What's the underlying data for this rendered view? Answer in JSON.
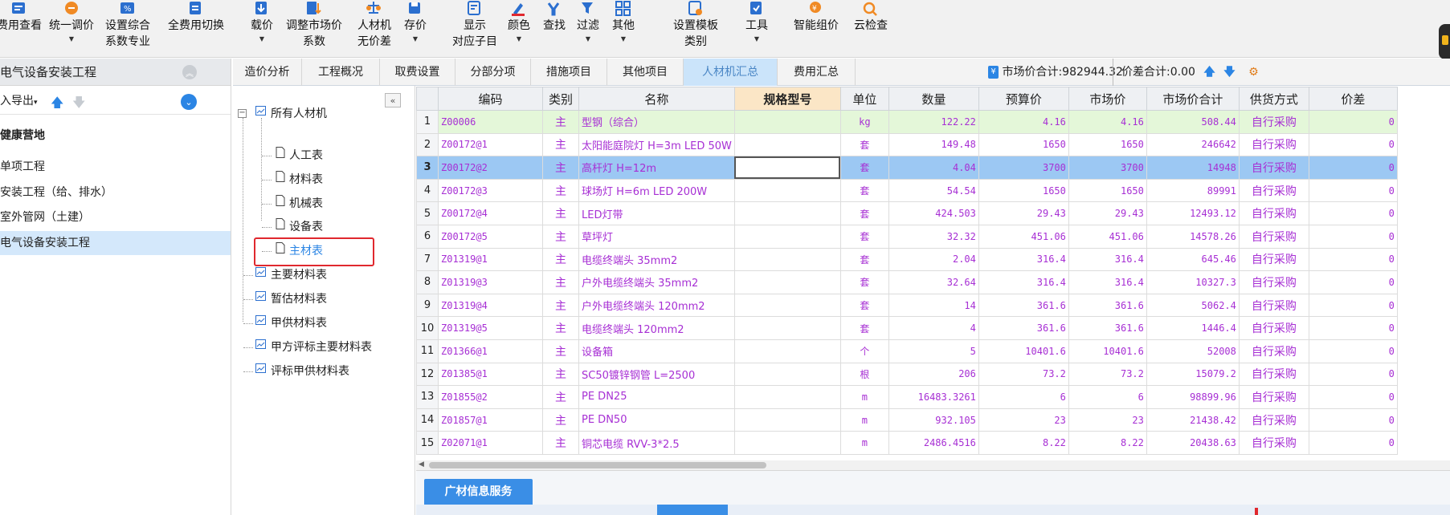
{
  "toolbar": [
    {
      "l1": "费用查看",
      "l2": "",
      "arrow": false,
      "icon": "fee-view-icon"
    },
    {
      "l1": "统一调价",
      "l2": "",
      "arrow": true,
      "icon": "unify-price-icon"
    },
    {
      "l1": "设置综合",
      "l2": "系数专业",
      "arrow": false,
      "icon": "set-coef-icon"
    },
    {
      "l1": "全费用切换",
      "l2": "",
      "arrow": false,
      "icon": "full-fee-switch-icon"
    },
    {
      "l1": "载价",
      "l2": "",
      "arrow": true,
      "icon": "load-price-icon"
    },
    {
      "l1": "调整市场价",
      "l2": "系数",
      "arrow": false,
      "icon": "adjust-market-icon"
    },
    {
      "l1": "人材机",
      "l2": "无价差",
      "arrow": false,
      "icon": "scale-icon"
    },
    {
      "l1": "存价",
      "l2": "",
      "arrow": true,
      "icon": "save-price-icon"
    },
    {
      "l1": "显示",
      "l2": "对应子目",
      "arrow": false,
      "icon": "show-sub-icon"
    },
    {
      "l1": "颜色",
      "l2": "",
      "arrow": true,
      "icon": "color-icon"
    },
    {
      "l1": "查找",
      "l2": "",
      "arrow": false,
      "icon": "find-icon"
    },
    {
      "l1": "过滤",
      "l2": "",
      "arrow": true,
      "icon": "filter-icon"
    },
    {
      "l1": "其他",
      "l2": "",
      "arrow": true,
      "icon": "grid-other-icon"
    },
    {
      "l1": "设置模板",
      "l2": "类别",
      "arrow": false,
      "icon": "template-icon"
    },
    {
      "l1": "工具",
      "l2": "",
      "arrow": true,
      "icon": "tool-icon"
    },
    {
      "l1": "智能组价",
      "l2": "",
      "arrow": false,
      "icon": "smart-price-icon"
    },
    {
      "l1": "云检查",
      "l2": "",
      "arrow": false,
      "icon": "cloud-check-icon"
    }
  ],
  "left_panel": {
    "title": "电气设备安装工程",
    "import_export": "入导出",
    "projects": [
      {
        "label": "健康营地",
        "bold": true,
        "selected": false
      },
      {
        "label": "单项工程",
        "bold": false,
        "selected": false
      },
      {
        "label": "安装工程（给、排水）",
        "bold": false,
        "selected": false
      },
      {
        "label": "室外管网（土建）",
        "bold": false,
        "selected": false
      },
      {
        "label": "电气设备安装工程",
        "bold": false,
        "selected": true
      }
    ]
  },
  "material_tree": {
    "root": "所有人材机",
    "children": [
      "人工表",
      "材料表",
      "机械表",
      "设备表",
      "主材表"
    ],
    "others": [
      "主要材料表",
      "暂估材料表",
      "甲供材料表",
      "甲方评标主要材料表",
      "评标甲供材料表"
    ]
  },
  "tabs": [
    {
      "label": "造价分析",
      "active": false
    },
    {
      "label": "工程概况",
      "active": false
    },
    {
      "label": "取费设置",
      "active": false
    },
    {
      "label": "分部分项",
      "active": false
    },
    {
      "label": "措施项目",
      "active": false
    },
    {
      "label": "其他项目",
      "active": false
    },
    {
      "label": "人材机汇总",
      "active": true
    },
    {
      "label": "费用汇总",
      "active": false
    }
  ],
  "summary": {
    "market_total": "市场价合计:982944.32",
    "diff_total": "价差合计:0.00"
  },
  "grid": {
    "columns": [
      "",
      "编码",
      "类别",
      "名称",
      "规格型号",
      "单位",
      "数量",
      "预算价",
      "市场价",
      "市场价合计",
      "供货方式",
      "价差"
    ],
    "rows": [
      {
        "n": "1",
        "code": "Z00006",
        "cat": "主",
        "name": "型钢（综合）",
        "spec": "",
        "unit": "kg",
        "qty": "122.22",
        "budget": "4.16",
        "market": "4.16",
        "total": "508.44",
        "supply": "自行采购",
        "diff": "0"
      },
      {
        "n": "2",
        "code": "Z00172@1",
        "cat": "主",
        "name": "太阳能庭院灯 H=3m LED 50W",
        "spec": "",
        "unit": "套",
        "qty": "149.48",
        "budget": "1650",
        "market": "1650",
        "total": "246642",
        "supply": "自行采购",
        "diff": "0"
      },
      {
        "n": "3",
        "code": "Z00172@2",
        "cat": "主",
        "name": "高杆灯 H=12m",
        "spec": "",
        "unit": "套",
        "qty": "4.04",
        "budget": "3700",
        "market": "3700",
        "total": "14948",
        "supply": "自行采购",
        "diff": "0"
      },
      {
        "n": "4",
        "code": "Z00172@3",
        "cat": "主",
        "name": "球场灯 H=6m LED 200W",
        "spec": "",
        "unit": "套",
        "qty": "54.54",
        "budget": "1650",
        "market": "1650",
        "total": "89991",
        "supply": "自行采购",
        "diff": "0"
      },
      {
        "n": "5",
        "code": "Z00172@4",
        "cat": "主",
        "name": "LED灯带",
        "spec": "",
        "unit": "套",
        "qty": "424.503",
        "budget": "29.43",
        "market": "29.43",
        "total": "12493.12",
        "supply": "自行采购",
        "diff": "0"
      },
      {
        "n": "6",
        "code": "Z00172@5",
        "cat": "主",
        "name": "草坪灯",
        "spec": "",
        "unit": "套",
        "qty": "32.32",
        "budget": "451.06",
        "market": "451.06",
        "total": "14578.26",
        "supply": "自行采购",
        "diff": "0"
      },
      {
        "n": "7",
        "code": "Z01319@1",
        "cat": "主",
        "name": "电缆终端头 35mm2",
        "spec": "",
        "unit": "套",
        "qty": "2.04",
        "budget": "316.4",
        "market": "316.4",
        "total": "645.46",
        "supply": "自行采购",
        "diff": "0"
      },
      {
        "n": "8",
        "code": "Z01319@3",
        "cat": "主",
        "name": "户外电缆终端头 35mm2",
        "spec": "",
        "unit": "套",
        "qty": "32.64",
        "budget": "316.4",
        "market": "316.4",
        "total": "10327.3",
        "supply": "自行采购",
        "diff": "0"
      },
      {
        "n": "9",
        "code": "Z01319@4",
        "cat": "主",
        "name": "户外电缆终端头 120mm2",
        "spec": "",
        "unit": "套",
        "qty": "14",
        "budget": "361.6",
        "market": "361.6",
        "total": "5062.4",
        "supply": "自行采购",
        "diff": "0"
      },
      {
        "n": "10",
        "code": "Z01319@5",
        "cat": "主",
        "name": "电缆终端头 120mm2",
        "spec": "",
        "unit": "套",
        "qty": "4",
        "budget": "361.6",
        "market": "361.6",
        "total": "1446.4",
        "supply": "自行采购",
        "diff": "0"
      },
      {
        "n": "11",
        "code": "Z01366@1",
        "cat": "主",
        "name": "设备箱",
        "spec": "",
        "unit": "个",
        "qty": "5",
        "budget": "10401.6",
        "market": "10401.6",
        "total": "52008",
        "supply": "自行采购",
        "diff": "0"
      },
      {
        "n": "12",
        "code": "Z01385@1",
        "cat": "主",
        "name": "SC50镀锌钢管 L=2500",
        "spec": "",
        "unit": "根",
        "qty": "206",
        "budget": "73.2",
        "market": "73.2",
        "total": "15079.2",
        "supply": "自行采购",
        "diff": "0"
      },
      {
        "n": "13",
        "code": "Z01855@2",
        "cat": "主",
        "name": "PE DN25",
        "spec": "",
        "unit": "m",
        "qty": "16483.3261",
        "budget": "6",
        "market": "6",
        "total": "98899.96",
        "supply": "自行采购",
        "diff": "0"
      },
      {
        "n": "14",
        "code": "Z01857@1",
        "cat": "主",
        "name": "PE DN50",
        "spec": "",
        "unit": "m",
        "qty": "932.105",
        "budget": "23",
        "market": "23",
        "total": "21438.42",
        "supply": "自行采购",
        "diff": "0"
      },
      {
        "n": "15",
        "code": "Z02071@1",
        "cat": "主",
        "name": "铜芯电缆 RVV-3*2.5",
        "spec": "",
        "unit": "m",
        "qty": "2486.4516",
        "budget": "8.22",
        "market": "8.22",
        "total": "20438.63",
        "supply": "自行采购",
        "diff": "0"
      }
    ]
  },
  "bottom_tab": "广材信息服务",
  "colors": {
    "accent": "#3a8ee6",
    "purple_text": "#a72fd4",
    "selected_row": "#9cc8f3",
    "green_row": "#e4f7d9",
    "highlight_box": "#e0282e"
  }
}
